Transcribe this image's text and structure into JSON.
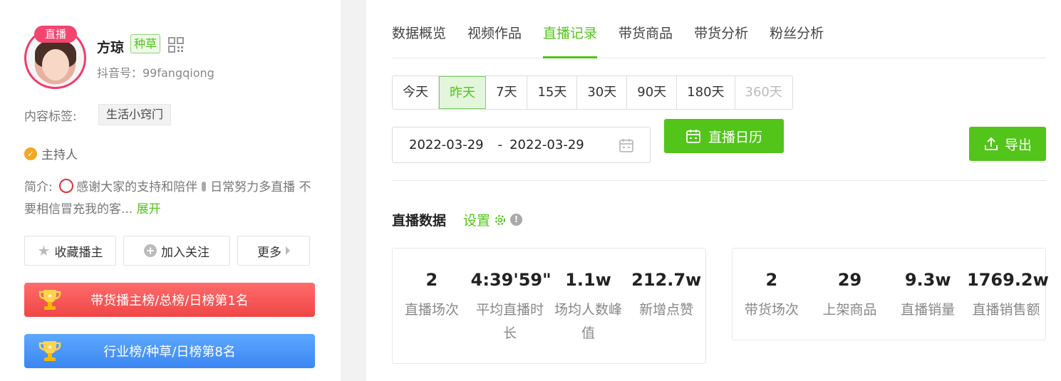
{
  "profile": {
    "live_badge": "直播",
    "name": "方琼",
    "tag": "种草",
    "douyin_id": "抖音号：99fangqiong",
    "content_label": "内容标签:",
    "content_tag": "生活小窍门",
    "role": "主持人",
    "bio_prefix": "简介:",
    "bio_text_1": "感谢大家的支持和陪伴",
    "bio_text_2": "日常努力多直播 不要相信冒充我的客...",
    "bio_expand": "展开",
    "buttons": {
      "favorite": "收藏播主",
      "follow": "加入关注",
      "more": "更多"
    },
    "ranks": [
      {
        "label": "带货播主榜/总榜/日榜第1名"
      },
      {
        "label": "行业榜/种草/日榜第8名"
      }
    ],
    "colors": {
      "accent": "#52c41a",
      "live": "#f3456e",
      "rank_red": "#f04646",
      "rank_blue": "#3b86f2"
    }
  },
  "tabs": [
    "数据概览",
    "视频作品",
    "直播记录",
    "带货商品",
    "带货分析",
    "粉丝分析"
  ],
  "active_tab": "直播记录",
  "ranges": [
    "今天",
    "昨天",
    "7天",
    "15天",
    "30天",
    "90天",
    "180天",
    "360天"
  ],
  "active_range": "昨天",
  "date_range": {
    "start": "2022-03-29",
    "separator": "-",
    "end": "2022-03-29"
  },
  "actions": {
    "calendar": "直播日历",
    "export": "导出"
  },
  "section": {
    "title": "直播数据",
    "settings": "设置"
  },
  "live_stats": [
    {
      "value": "2",
      "label": "直播场次"
    },
    {
      "value": "4:39'59\"",
      "label": "平均直播时长"
    },
    {
      "value": "1.1w",
      "label": "场均人数峰值"
    },
    {
      "value": "212.7w",
      "label": "新增点赞"
    }
  ],
  "sales_stats": [
    {
      "value": "2",
      "label": "带货场次"
    },
    {
      "value": "29",
      "label": "上架商品"
    },
    {
      "value": "9.3w",
      "label": "直播销量"
    },
    {
      "value": "1769.2w",
      "label": "直播销售额"
    }
  ]
}
